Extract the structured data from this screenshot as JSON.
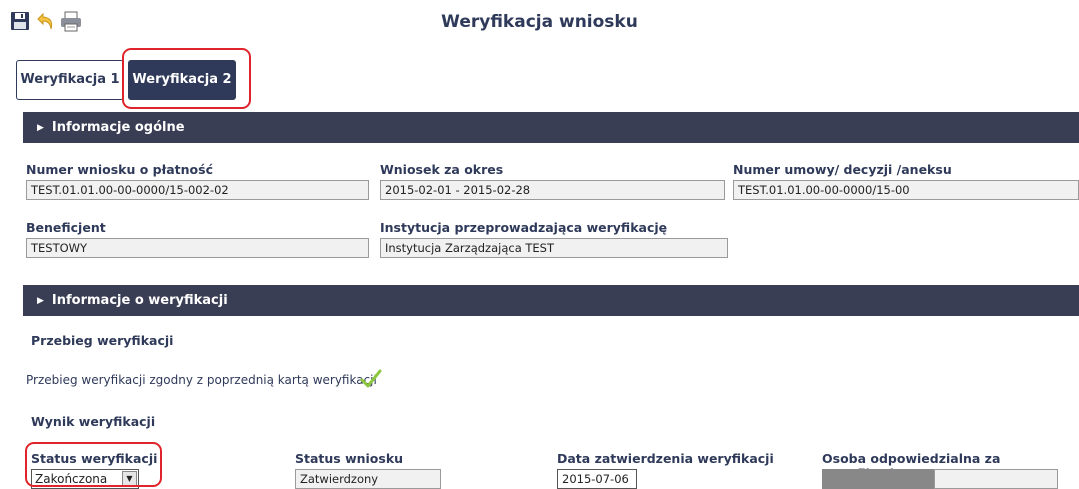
{
  "page": {
    "title": "Weryfikacja wniosku"
  },
  "toolbar": {
    "save": "save-icon",
    "undo": "undo-icon",
    "print": "print-icon"
  },
  "tabs": [
    {
      "label": "Weryfikacja 1"
    },
    {
      "label": "Weryfikacja 2",
      "active": true
    }
  ],
  "sections": {
    "general": {
      "title": "Informacje ogólne",
      "fields": {
        "numer_wniosku": {
          "label": "Numer wniosku o płatność",
          "value": "TEST.01.01.00-00-0000/15-002-02"
        },
        "wniosek_za_okres": {
          "label": "Wniosek za okres",
          "value": "2015-02-01 - 2015-02-28"
        },
        "numer_umowy": {
          "label": "Numer umowy/ decyzji /aneksu",
          "value": "TEST.01.01.00-00-0000/15-00"
        },
        "beneficjent": {
          "label": "Beneficjent",
          "value": "TESTOWY"
        },
        "instytucja": {
          "label": "Instytucja przeprowadzająca weryfikację",
          "value": "Instytucja Zarządzająca TEST"
        }
      }
    },
    "verification": {
      "title": "Informacje o weryfikacji",
      "przebieg_heading": "Przebieg weryfikacji",
      "przebieg_text": "Przebieg weryfikacji zgodny z poprzednią kartą weryfikacji",
      "wynik_heading": "Wynik weryfikacji",
      "fields": {
        "status_weryfikacji": {
          "label": "Status weryfikacji",
          "value": "Zakończona"
        },
        "status_wniosku": {
          "label": "Status wniosku",
          "value": "Zatwierdzony"
        },
        "data_zatwierdzenia": {
          "label": "Data zatwierdzenia weryfikacji",
          "value": "2015-07-06"
        },
        "osoba": {
          "label": "Osoba odpowiedzialna za weryfikację",
          "value": ""
        }
      }
    }
  },
  "colors": {
    "bar": "#3a3e55",
    "accent": "#2f3a5a",
    "highlight": "#e0242c",
    "check": "#8cc63f"
  }
}
